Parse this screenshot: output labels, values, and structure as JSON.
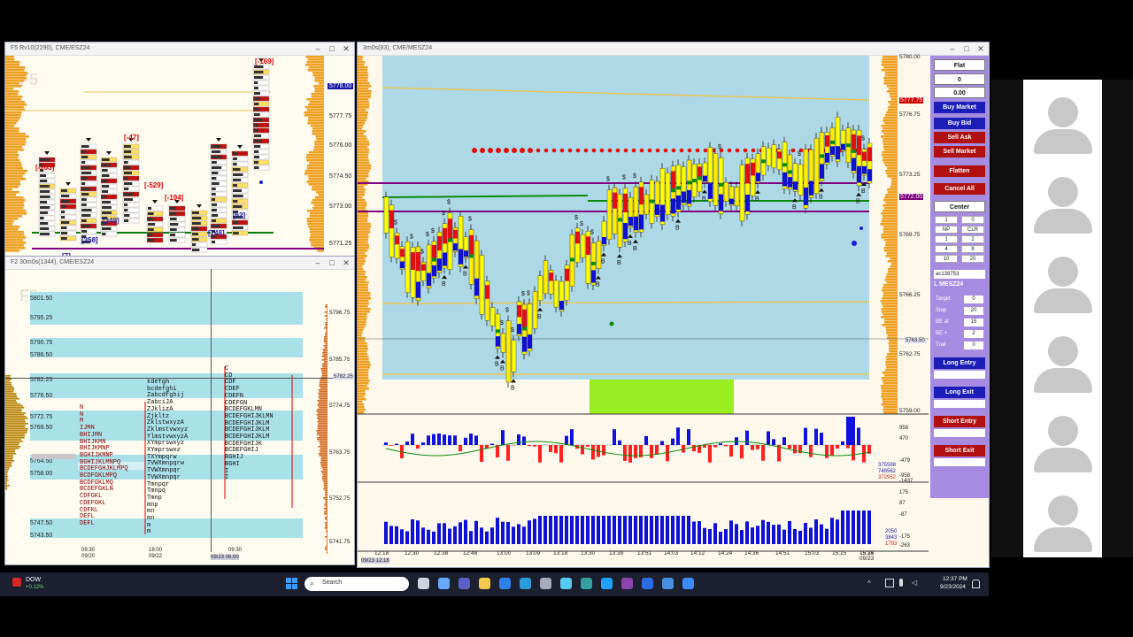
{
  "windows": {
    "f5": {
      "title": "F5 Rv10(2290), CME/ESZ24",
      "watermark": "F5",
      "prices": [
        "5778.00",
        "5777.75",
        "5776.00",
        "5774.50",
        "5773.00",
        "5771.25"
      ],
      "current_price_tag": "5778.00",
      "delta_labels": [
        "[-169]",
        "[-203]",
        "[-47]",
        "[-529]",
        "[-194]",
        "[349]",
        "[358]",
        "[748]",
        "[62]",
        "[7]"
      ]
    },
    "f2": {
      "title": "F2 30m0s(1344), CME/ESZ24",
      "watermark": "F2",
      "band_prices": [
        "5801.50",
        "5795.25",
        "5790.75",
        "5786.50",
        "5782.25",
        "5776.50",
        "5772.75",
        "5769.50",
        "5764.50",
        "5758.00",
        "5747.50",
        "5743.50"
      ],
      "axis_prices": [
        "5796.75",
        "5785.75",
        "5774.75",
        "5763.75",
        "5752.75",
        "5741.75"
      ],
      "cursor_price_tag": "5782.25",
      "date_labels": [
        "09:30",
        "09/20",
        "18:00",
        "09/22",
        "09:30",
        "09/23"
      ],
      "cursor_time_tag": "09/23 06:00",
      "tpo_columns": [
        [
          "N",
          "N",
          "M",
          "IJMN",
          "BHIJMN",
          "BHIJKMN",
          "BHIJKMNP",
          "BGHIJKMNP",
          "BGHIJKLMNPQ",
          "BCDEFGHJKLMPQ",
          "BCDFGKLMPQ",
          "BCDFGKLMQ",
          "BCDEFGKLN",
          "CDFGKL",
          "CDEFGKL",
          "CDFKL",
          "DEFL",
          "DEFL"
        ],
        [
          "kdefgh",
          "bcdefghi",
          "Zabcdfghij",
          "ZabciJA",
          "ZJklizA",
          "Zjkltz",
          "ZklstwxyzA",
          "Zklmstvwxyz",
          "YlmstvwxyzA",
          "XYmprswxyz",
          "XYmprswxz",
          "TXYmpqrw",
          "TVWXmnpqrw",
          "TVWXmnpqr",
          "TVWXmnpqr",
          "Tmnpqr",
          "Tmnpq",
          "Tmnp",
          "mnp",
          "mn",
          "mn",
          "m",
          "m"
        ],
        [
          "C",
          "CD",
          "CDF",
          "CDEF",
          "CDEFN",
          "CDEFGN",
          "BCDEFGKLMN",
          "BCDEFGHIJKLMN",
          "BCDEFGHIJKLM",
          "BCDEFGHIJKLM",
          "BCDEFGHIJKLM",
          "BCDEFGHIJK",
          "BCDEFGHIJ",
          "BGHIJ",
          "BGHI",
          "I",
          "I"
        ]
      ]
    },
    "main": {
      "title": "3m0s(83), CME/MESZ24",
      "prices": [
        "5780.00",
        "5776.75",
        "5773.25",
        "5769.75",
        "5766.25",
        "5762.75",
        "5759.00"
      ],
      "current_price_tag": "5777.75",
      "mid_price_tag": "5772.00",
      "cursor_price_tag": "5763.50",
      "time_labels": [
        "12:18",
        "12:30",
        "12:38",
        "12:48",
        "13:00",
        "13:09",
        "13:18",
        "13:30",
        "13:39",
        "13:51",
        "14:03",
        "14:12",
        "14:24",
        "14:36",
        "14:51",
        "15:03",
        "15:15",
        "15:27",
        "15:36",
        "09/23"
      ],
      "first_time_tag": "09/23 12:18",
      "osc_scale": [
        "958",
        "470",
        "-479",
        "-958",
        "-1437"
      ],
      "osc_values": [
        "375598",
        "748562",
        "372952"
      ],
      "vol_scale": [
        "175",
        "87",
        "-87",
        "-175",
        "-263"
      ],
      "vol_values": [
        "2050",
        "3843",
        "1793"
      ]
    }
  },
  "dom": {
    "position": "Flat",
    "qty": "0",
    "pnl": "0.00",
    "buttons": {
      "buy_market": "Buy Market",
      "buy_bid": "Buy Bid",
      "sell_ask": "Sell Ask",
      "sell_market": "Sell Market",
      "flatten": "Flatten",
      "cancel_all": "Cancel All",
      "center": "Center"
    },
    "qty_grid": [
      "1",
      "0",
      "NP",
      "CLR",
      "1",
      "2",
      "4",
      "8",
      "10",
      "20"
    ],
    "account": "ac138753",
    "instrument": "L MESZ24",
    "fields": [
      {
        "label": "Target",
        "value": "0"
      },
      {
        "label": "Stop",
        "value": "20"
      },
      {
        "label": "BE at",
        "value": "15"
      },
      {
        "label": "BE +",
        "value": "2"
      },
      {
        "label": "Trail",
        "value": "0"
      }
    ],
    "strategy_buttons": [
      "Long Entry",
      "Long Exit",
      "Short Entry",
      "Short Exit"
    ]
  },
  "taskbar": {
    "ticker": "DOW",
    "ticker_change": "+0.12%",
    "search_placeholder": "Search",
    "time": "12:37 PM",
    "date": "9/23/2024"
  },
  "colors": {
    "chart_bg": "#add8e6",
    "band": "#a8e1e8",
    "up": "#ffff00",
    "down": "#ff0000",
    "poc_line": "#800080",
    "green_line": "#008000",
    "dom_panel": "#a68ce0",
    "taskbar": "#1c1f2e"
  }
}
